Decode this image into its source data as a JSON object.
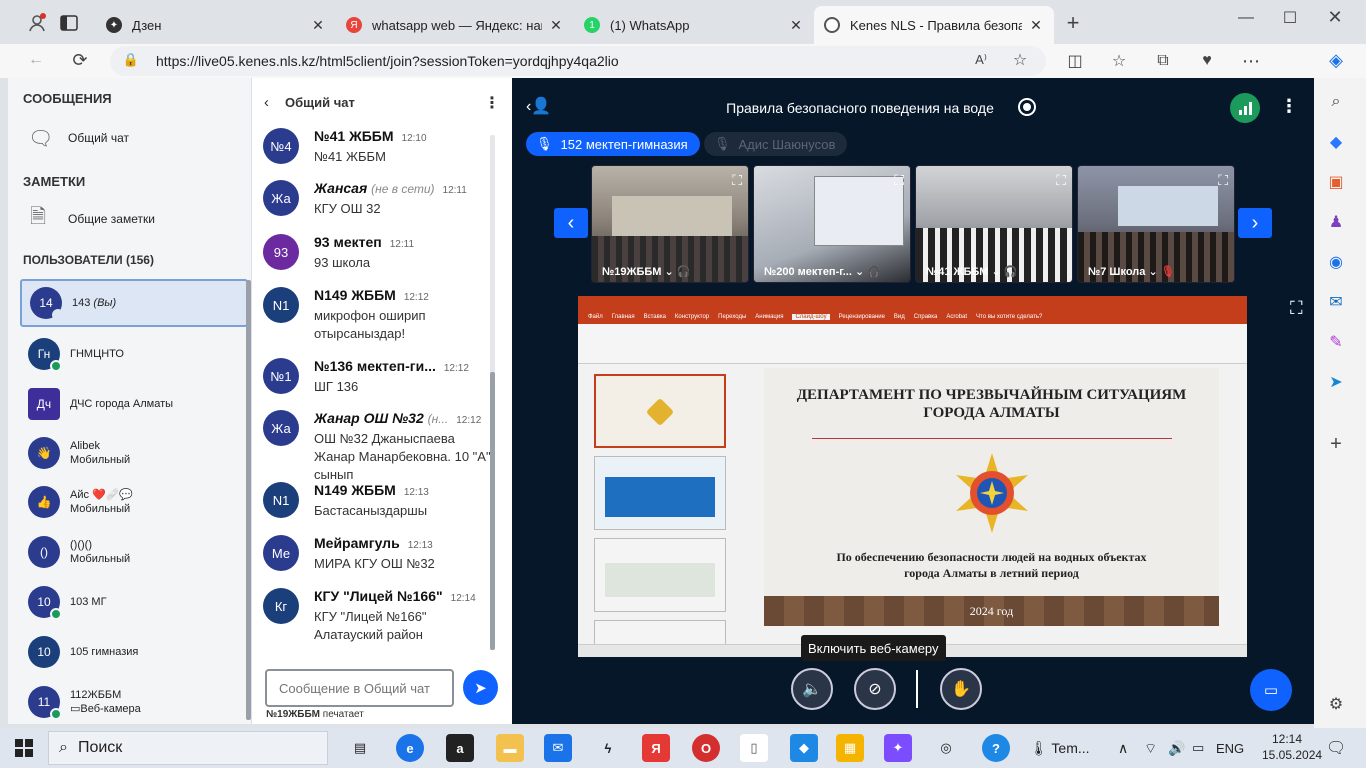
{
  "browser": {
    "tabs": [
      {
        "label": "Дзен",
        "active": false
      },
      {
        "label": "whatsapp web — Яндекс: нашло",
        "active": false
      },
      {
        "label": "(1) WhatsApp",
        "active": false
      },
      {
        "label": "Kenes NLS - Правила безопасн",
        "active": true
      }
    ],
    "url": "https://live05.kenes.nls.kz/html5client/join?sessionToken=yordqjhpy4qa2lio"
  },
  "left": {
    "messages_header": "СООБЩЕНИЯ",
    "public_chat": "Общий чат",
    "notes_header": "ЗАМЕТКИ",
    "shared_notes": "Общие заметки",
    "users_header": "ПОЛЬЗОВАТЕЛИ (156)",
    "users": [
      {
        "initials": "14",
        "name": "143",
        "sub": "(Вы)",
        "color": "#2b3c8f"
      },
      {
        "initials": "Гн",
        "name": "ГНМЦНТО",
        "sub": "",
        "color": "#1b3f7a"
      },
      {
        "initials": "Дч",
        "name": "ДЧС города Алматы",
        "sub": "",
        "color": "#3d2f9a"
      },
      {
        "initials": "👋",
        "name": "Alibek",
        "sub": "Мобильный",
        "color": "#2b3c8f"
      },
      {
        "initials": "👍",
        "name": "Айс ❤️🩹💬",
        "sub": "Мобильный",
        "color": "#2b3c8f"
      },
      {
        "initials": "()",
        "name": "()()()",
        "sub": "Мобильный",
        "color": "#2b3c8f"
      },
      {
        "initials": "10",
        "name": "103 МГ",
        "sub": "",
        "color": "#2b3c8f"
      },
      {
        "initials": "10",
        "name": "105 гимназия",
        "sub": "",
        "color": "#1b3f7a"
      },
      {
        "initials": "11",
        "name": "112ЖББМ",
        "sub": "Веб-камера",
        "color": "#2b3c8f"
      }
    ]
  },
  "chat": {
    "title": "Общий чат",
    "messages": [
      {
        "initials": "№4",
        "name": "№41 ЖББМ",
        "time": "12:10",
        "status": "",
        "text": "№41 ЖББМ",
        "color": "#2b3c8f"
      },
      {
        "initials": "Жа",
        "name": "Жансая",
        "time": "12:11",
        "status": "(не в сети)",
        "text": "КГУ ОШ 32",
        "color": "#2b3c8f"
      },
      {
        "initials": "93",
        "name": "93 мектеп",
        "time": "12:11",
        "status": "",
        "text": "93 школа",
        "color": "#6b2aa0"
      },
      {
        "initials": "N1",
        "name": "N149 ЖББМ",
        "time": "12:12",
        "status": "",
        "text": "микрофон оширип отырсаныздар!",
        "color": "#1b3f7a"
      },
      {
        "initials": "№1",
        "name": "№136 мектеп-ги...",
        "time": "12:12",
        "status": "",
        "text": "ШГ 136",
        "color": "#2b3c8f"
      },
      {
        "initials": "Жа",
        "name": "Жанар ОШ №32",
        "time": "12:12",
        "status": "(н...",
        "text": "ОШ №32 Джаныспаева Жанар Манарбековна. 10 \"А\" сынып",
        "color": "#2b3c8f"
      },
      {
        "initials": "N1",
        "name": "N149 ЖББМ",
        "time": "12:13",
        "status": "",
        "text": "Бастасаныздаршы",
        "color": "#1b3f7a"
      },
      {
        "initials": "Ме",
        "name": "Мейрамгуль",
        "time": "12:13",
        "status": "",
        "text": "МИРА КГУ ОШ №32",
        "color": "#2b3c8f"
      },
      {
        "initials": "Кг",
        "name": "КГУ \"Лицей №166\"",
        "time": "12:14",
        "status": "",
        "text": "КГУ \"Лицей №166\" Алатауский район",
        "color": "#1b3f7a"
      }
    ],
    "input_placeholder": "Сообщение в Общий чат",
    "typing": "№19ЖББМ",
    "typing_suffix": "печатает"
  },
  "main": {
    "meeting_title": "Правила безопасного поведения на воде",
    "talker1": "152 мектеп-гимназия",
    "talker2": "Адис Шаюнусов",
    "videos": [
      {
        "label": "№19ЖББМ"
      },
      {
        "label": "№200 мектеп-г..."
      },
      {
        "label": "№41 ЖББМ"
      },
      {
        "label": "№7 Школа"
      }
    ],
    "slide": {
      "title_line1": "ДЕПАРТАМЕНТ ПО ЧРЕЗВЫЧАЙНЫМ СИТУАЦИЯМ",
      "title_line2": "ГОРОДА АЛМАТЫ",
      "subtitle_line1": "По обеспечению безопасности людей на водных объектах",
      "subtitle_line2": "города Алматы в летний период",
      "year": "2024 год",
      "ppt_tabs": [
        "Файл",
        "Главная",
        "Вставка",
        "Конструктор",
        "Переходы",
        "Анимация",
        "Слайд-шоу",
        "Рецензирование",
        "Вид",
        "Справка",
        "Acrobat",
        "Что вы хотите сделать?"
      ]
    },
    "tooltip": "Включить веб-камеру"
  },
  "taskbar": {
    "search": "Поиск",
    "temp": "Tem...",
    "lang": "ENG",
    "time": "12:14",
    "date": "15.05.2024"
  },
  "colors": {
    "accent": "#0f62fe",
    "dark_bg": "#06172a",
    "avatar_blue": "#2b3c8f",
    "online": "#1b9a5b"
  }
}
